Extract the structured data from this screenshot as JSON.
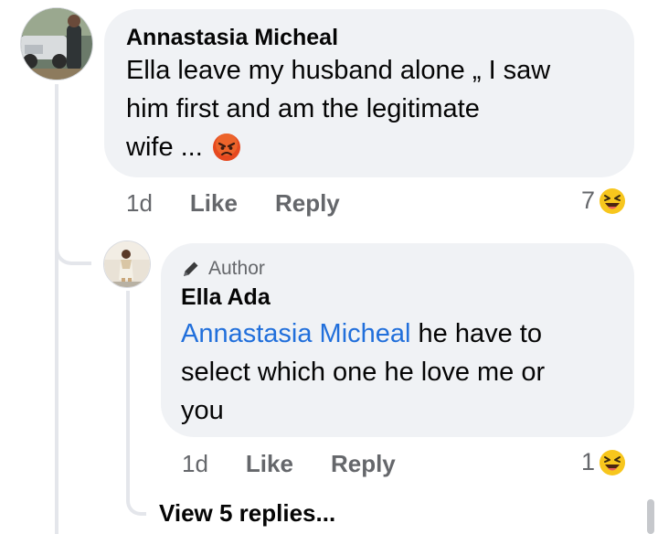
{
  "comment": {
    "author": "Annastasia Micheal",
    "text_lines": [
      "Ella leave my husband alone „ I saw",
      "him first and am the legitimate",
      "wife ..."
    ],
    "time": "1d",
    "like_label": "Like",
    "reply_label": "Reply",
    "reaction_count": "7",
    "emoji_icon": "angry-face-emoji",
    "reaction_icon": "laughing-emoji"
  },
  "reply": {
    "badge": "Author",
    "author": "Ella Ada",
    "mention": "Annastasia Micheal",
    "text_lines": [
      " he have to",
      "select which one he love me or",
      "you"
    ],
    "time": "1d",
    "like_label": "Like",
    "reply_label": "Reply",
    "reaction_count": "1",
    "reaction_icon": "laughing-emoji"
  },
  "view_replies_label": "View 5 replies...",
  "colors": {
    "bubble": "#f0f2f5",
    "meta_text": "#65676b",
    "mention": "#216fdb",
    "thread_line": "#e4e6eb"
  }
}
